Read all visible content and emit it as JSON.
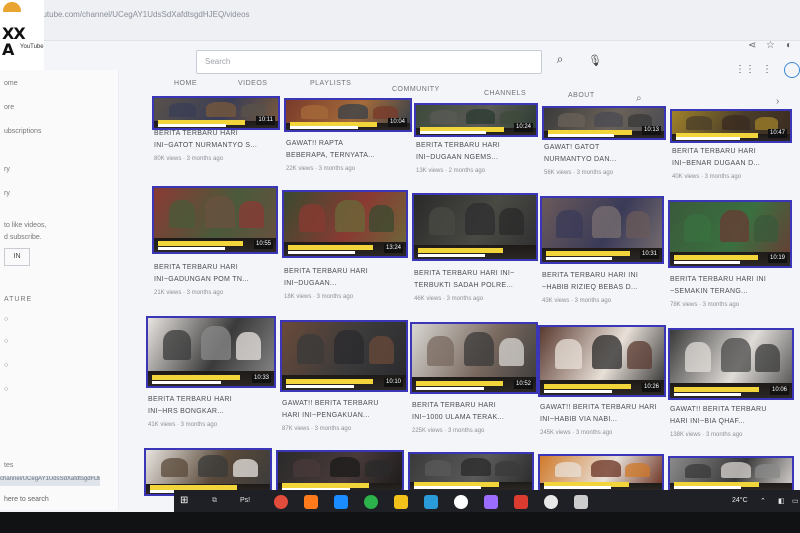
{
  "browser": {
    "url": "youtube.com/channel/UCegAY1UdsSdXafdtsgdHJEQ/videos",
    "icons": [
      "share-icon",
      "star-icon",
      "profile-icon"
    ]
  },
  "channel": {
    "logo_line1": "XX",
    "logo_line2": "A",
    "logo_sub": "YouTube"
  },
  "search": {
    "placeholder": "Search"
  },
  "tabs": [
    "HOME",
    "VIDEOS",
    "PLAYLISTS",
    "COMMUNITY",
    "CHANNELS",
    "ABOUT"
  ],
  "sidebar": {
    "items": [
      "ome",
      "ore",
      "ubscriptions",
      "ry",
      "ry"
    ],
    "signin_text": [
      "to like videos,",
      "d subscribe."
    ],
    "signin_button": "IN",
    "section_header": "ATURE",
    "bottom_items": [
      "tes"
    ],
    "tooltip": "channel/UCegAY1UdsSdXafdtsgdHJEQ/videos",
    "search_hint": "here to search"
  },
  "videos": [
    {
      "title1": "BERITA TERBARU HARI",
      "title2": "INI~GATOT NURMANTYO S...",
      "meta": "80K views · 3 months ago",
      "dur": "10:11",
      "colors": [
        "#58514a",
        "#3a3d56",
        "#7a5a3a"
      ]
    },
    {
      "title1": "GAWAT!! RAPTA",
      "title2": "BEBERAPA, TERNYATA...",
      "meta": "22K views · 3 months ago",
      "dur": "10:04",
      "colors": [
        "#7a3a2a",
        "#a56b3a",
        "#35404a"
      ]
    },
    {
      "title1": "BERITA TERBARU HARI",
      "title2": "INI~DUGAAN NGEMS...",
      "meta": "13K views · 2 months ago",
      "dur": "10:24",
      "colors": [
        "#3d4a3a",
        "#5a5a56",
        "#2a3a30"
      ]
    },
    {
      "title1": "GAWAT! GATOT",
      "title2": "NURMANTYO DAN...",
      "meta": "56K views · 3 months ago",
      "dur": "10:13",
      "colors": [
        "#3a3a3a",
        "#6a6258",
        "#4a4a52"
      ]
    },
    {
      "title1": "BERITA TERBARU HARI",
      "title2": "INI~BENAR DUGAAN D...",
      "meta": "40K views · 3 months ago",
      "dur": "10:47",
      "colors": [
        "#a0822a",
        "#4a3e2a",
        "#3a2a20"
      ]
    },
    {
      "title1": "BERITA TERBARU HARI",
      "title2": "INI~GADUNGAN POM TN...",
      "meta": "21K views · 3 months ago",
      "dur": "10:55",
      "colors": [
        "#8a3a34",
        "#4a5a3a",
        "#6a5040"
      ]
    },
    {
      "title1": "BERITA TERBARU HARI",
      "title2": "INI~DUGAAN...",
      "meta": "18K views · 3 months ago",
      "dur": "13:24",
      "colors": [
        "#3a4a30",
        "#8a3a32",
        "#6a6a3a"
      ]
    },
    {
      "title1": "BERITA TERBARU HARI INI~",
      "title2": "TERBUKTI SADAH POLRE...",
      "meta": "46K views · 3 months ago",
      "dur": "",
      "colors": [
        "#2a2a2a",
        "#4a4a44",
        "#2e2e30"
      ]
    },
    {
      "title1": "BERITA TERBARU HARI INI",
      "title2": "~HABIB RIZIEQ BEBAS D...",
      "meta": "43K views · 3 months ago",
      "dur": "10:31",
      "colors": [
        "#6a5a5a",
        "#3a3a58",
        "#7a7070"
      ]
    },
    {
      "title1": "BERITA TERBARU HARI INI",
      "title2": "~SEMAKIN TERANG...",
      "meta": "78K views · 3 months ago",
      "dur": "10:19",
      "colors": [
        "#3a5a3a",
        "#3a7040",
        "#6a3a34"
      ]
    },
    {
      "title1": "BERITA TERBARU HARI",
      "title2": "INI~HRS BONGKAR...",
      "meta": "41K views · 3 months ago",
      "dur": "10:33",
      "colors": [
        "#e8e4e0",
        "#3a3a3a",
        "#8a8a8a"
      ]
    },
    {
      "title1": "GAWAT!! BERITA TERBARU",
      "title2": "HARI INI~PENGAKUAN...",
      "meta": "87K views · 3 months ago",
      "dur": "10:10",
      "colors": [
        "#6a4a3a",
        "#3a3a3a",
        "#2a2a2e"
      ]
    },
    {
      "title1": "BERITA TERBARU HARI",
      "title2": "INI~1000 ULAMA TERAK...",
      "meta": "225K views · 3 months ago",
      "dur": "10:52",
      "colors": [
        "#d8d6d2",
        "#7a6a60",
        "#3a3a3a"
      ]
    },
    {
      "title1": "GAWAT!! BERITA TERBARU HARI",
      "title2": "INI~HABIB VIA NABI...",
      "meta": "245K views · 3 months ago",
      "dur": "10:26",
      "colors": [
        "#5a3a30",
        "#e8e0d8",
        "#2a2a2a"
      ]
    },
    {
      "title1": "GAWAT!! BERITA TERBARU",
      "title2": "HARI INI~BIA QHAF...",
      "meta": "138K views · 3 months ago",
      "dur": "10:06",
      "colors": [
        "#3a3a3a",
        "#e0dcd8",
        "#4a4a4a"
      ]
    },
    {
      "title1": "",
      "title2": "",
      "meta": "",
      "dur": "",
      "colors": [
        "#e8e4e0",
        "#5a4a3a",
        "#3a3a3a"
      ]
    },
    {
      "title1": "",
      "title2": "",
      "meta": "",
      "dur": "",
      "colors": [
        "#2a2a2a",
        "#4a3a3a",
        "#1a1a1a"
      ]
    },
    {
      "title1": "",
      "title2": "",
      "meta": "",
      "dur": "",
      "colors": [
        "#3a3a3a",
        "#5a5a5a",
        "#2a2a2a"
      ]
    },
    {
      "title1": "",
      "title2": "",
      "meta": "",
      "dur": "",
      "colors": [
        "#d07a2a",
        "#e8e0d8",
        "#6a3020"
      ]
    },
    {
      "title1": "",
      "title2": "",
      "meta": "",
      "dur": "",
      "colors": [
        "#8a8a8a",
        "#3a3a3a",
        "#d8d4d0"
      ]
    }
  ],
  "taskbar": {
    "search_label": "Ps!",
    "tray_temp": "24°C",
    "app_colors": [
      "#e24c3b",
      "#ff7a1a",
      "#1a8cff",
      "#2cb24a",
      "#f2c21a",
      "#2a9bd8",
      "#ffffff",
      "#9c6cff",
      "#dc3b30",
      "#e8e8e8",
      "#cccccc"
    ]
  }
}
